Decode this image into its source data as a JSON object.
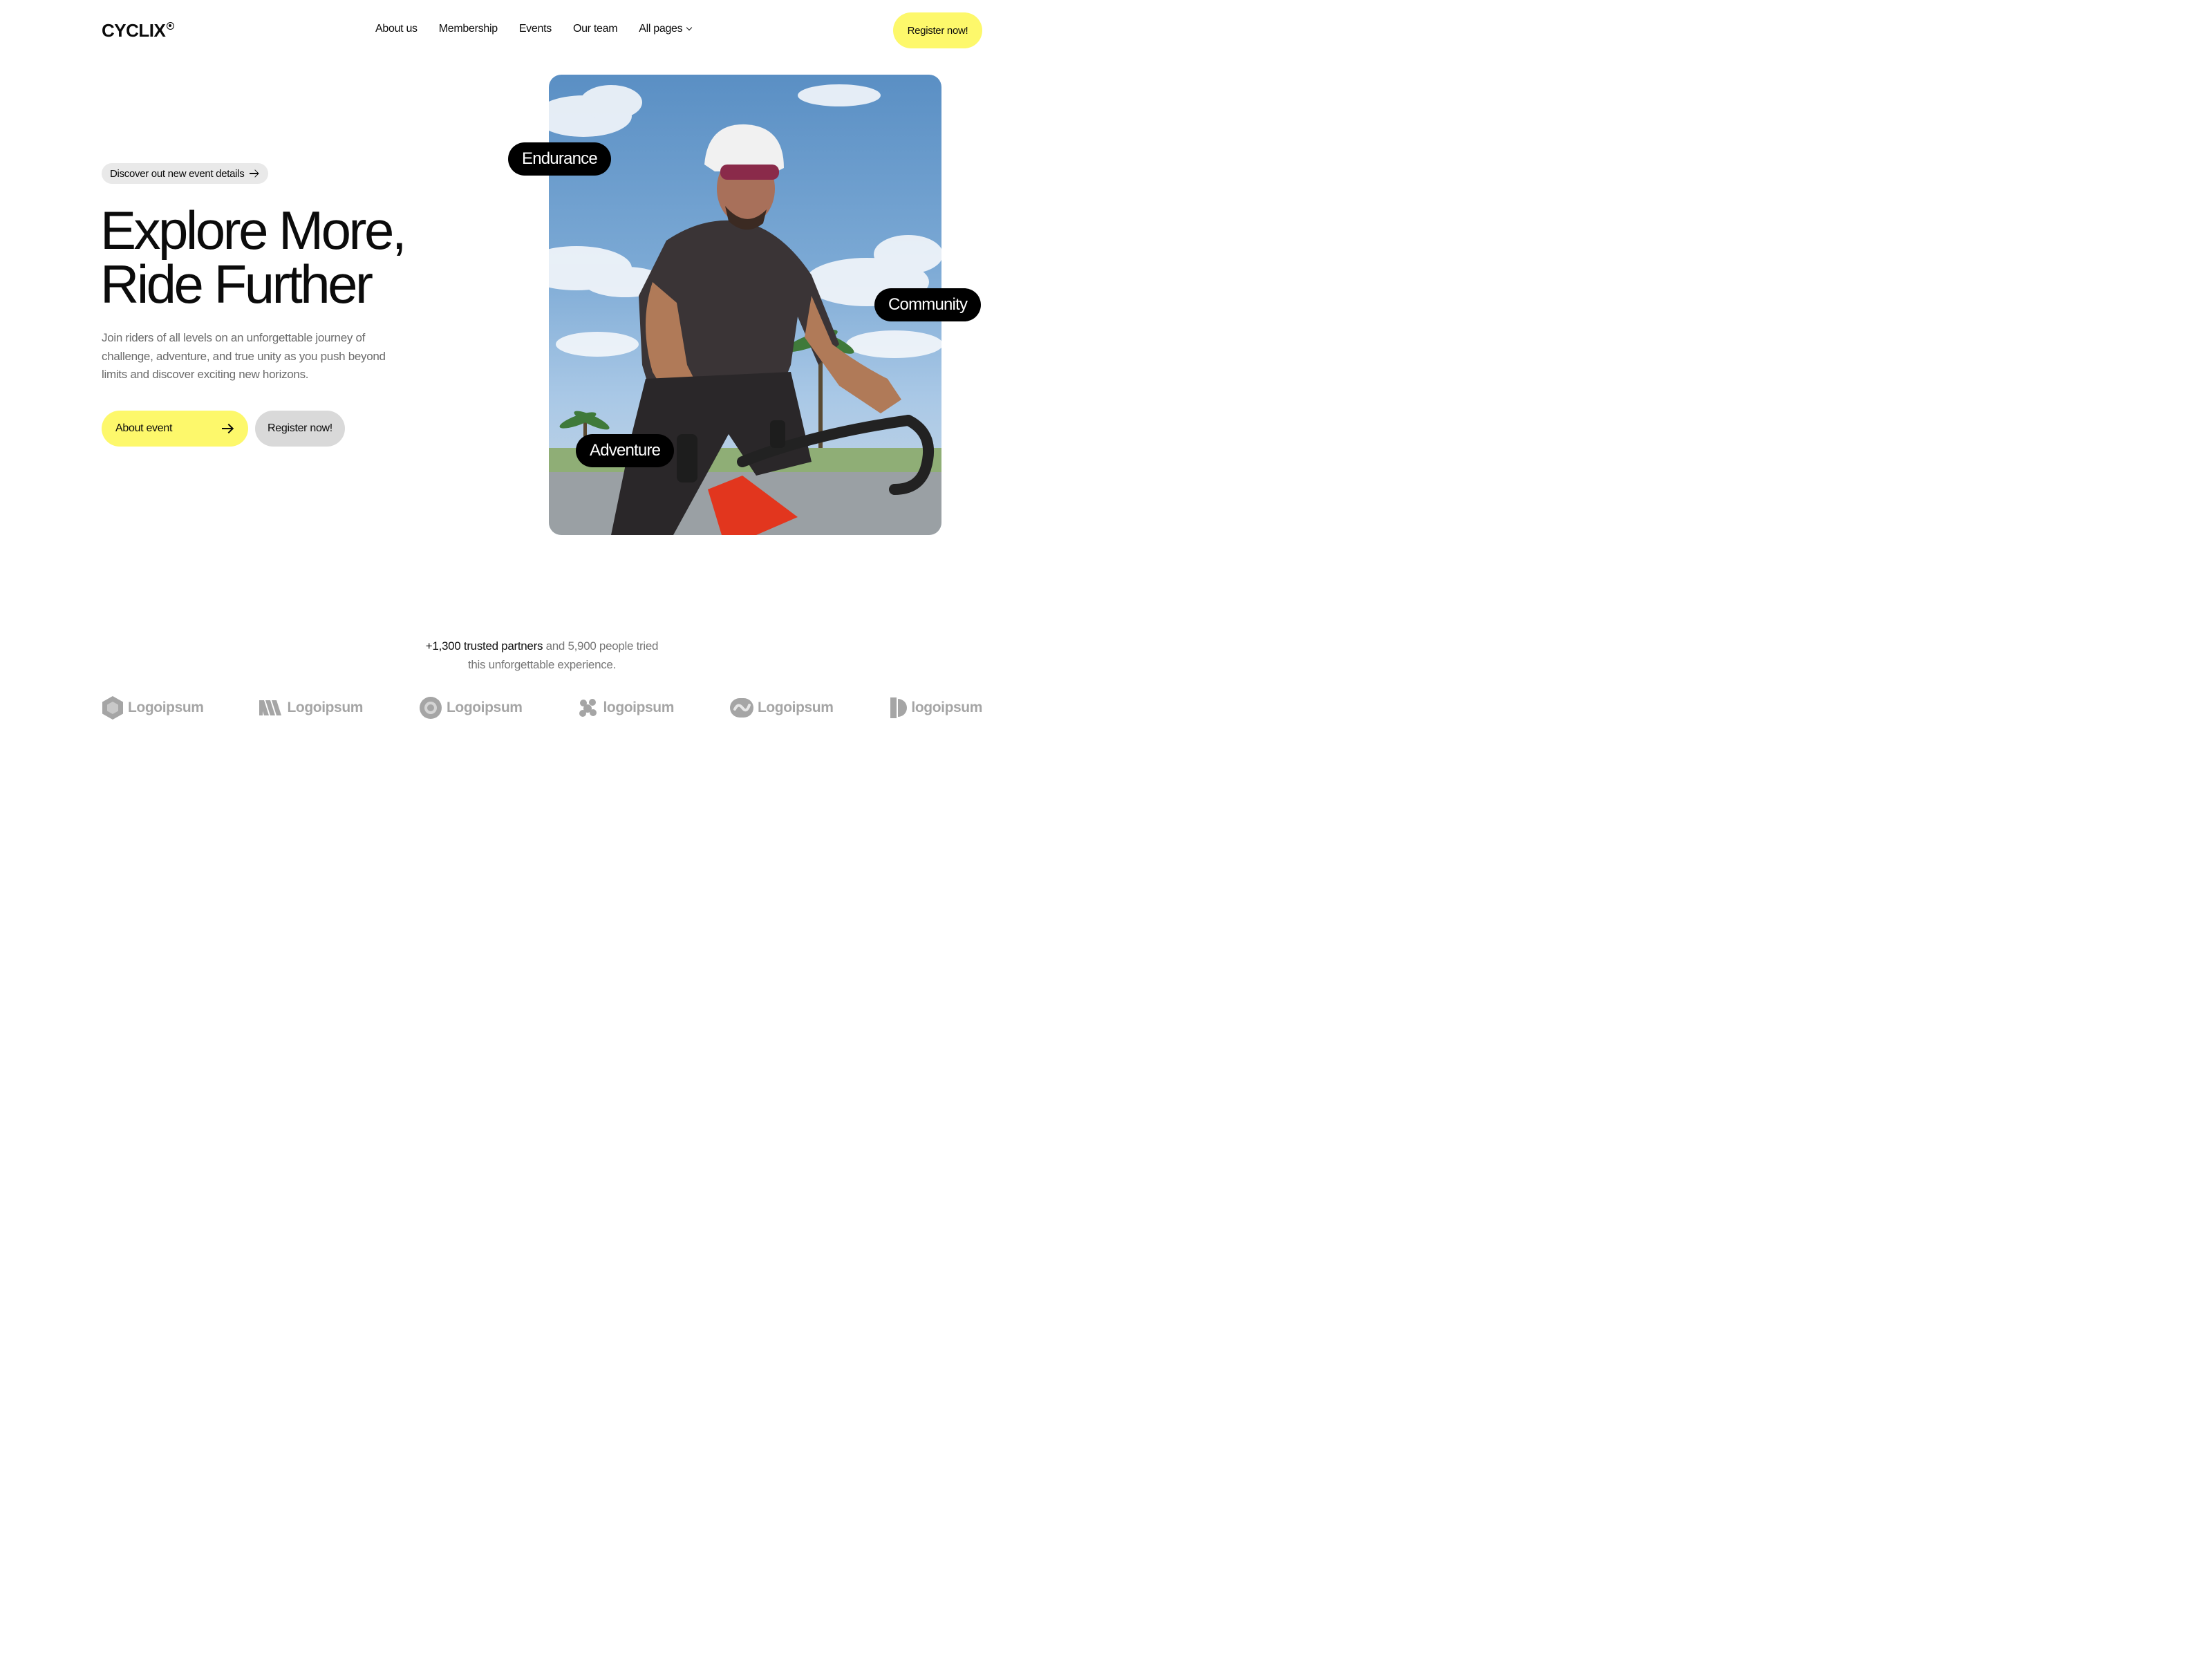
{
  "brand": {
    "name": "CYCLIX"
  },
  "nav": {
    "items": [
      {
        "label": "About us"
      },
      {
        "label": "Membership"
      },
      {
        "label": "Events"
      },
      {
        "label": "Our team"
      },
      {
        "label": "All pages"
      }
    ],
    "cta": "Register now!"
  },
  "hero": {
    "pill": "Discover out new event details",
    "title_line1": "Explore More,",
    "title_line2": "Ride Further",
    "description": "Join riders of all levels on an unforgettable journey of challenge, adventure, and true unity as you push beyond limits and discover exciting new horizons.",
    "primary_button": "About event",
    "secondary_button": "Register now!",
    "tags": {
      "endurance": "Endurance",
      "community": "Community",
      "adventure": "Adventure"
    }
  },
  "partners": {
    "count_text": "+1,300 trusted partners",
    "rest_line1": " and 5,900 people tried",
    "line2": "this unforgettable experience.",
    "logos": [
      {
        "label": "Logoipsum",
        "icon": "hexagon-icon"
      },
      {
        "label": "Logoipsum",
        "icon": "stripes-icon"
      },
      {
        "label": "Logoipsum",
        "icon": "gear-badge-icon"
      },
      {
        "label": "logoipsum",
        "icon": "blob-icon"
      },
      {
        "label": "Logoipsum",
        "icon": "swirl-icon"
      },
      {
        "label": "logoipsum",
        "icon": "split-circle-icon"
      }
    ]
  },
  "colors": {
    "accent": "#fdf86b",
    "text": "#0b0b0b",
    "muted": "#6b6b6b",
    "pill_grey": "#e9e9e9",
    "logo_grey": "#a5a5a5"
  }
}
